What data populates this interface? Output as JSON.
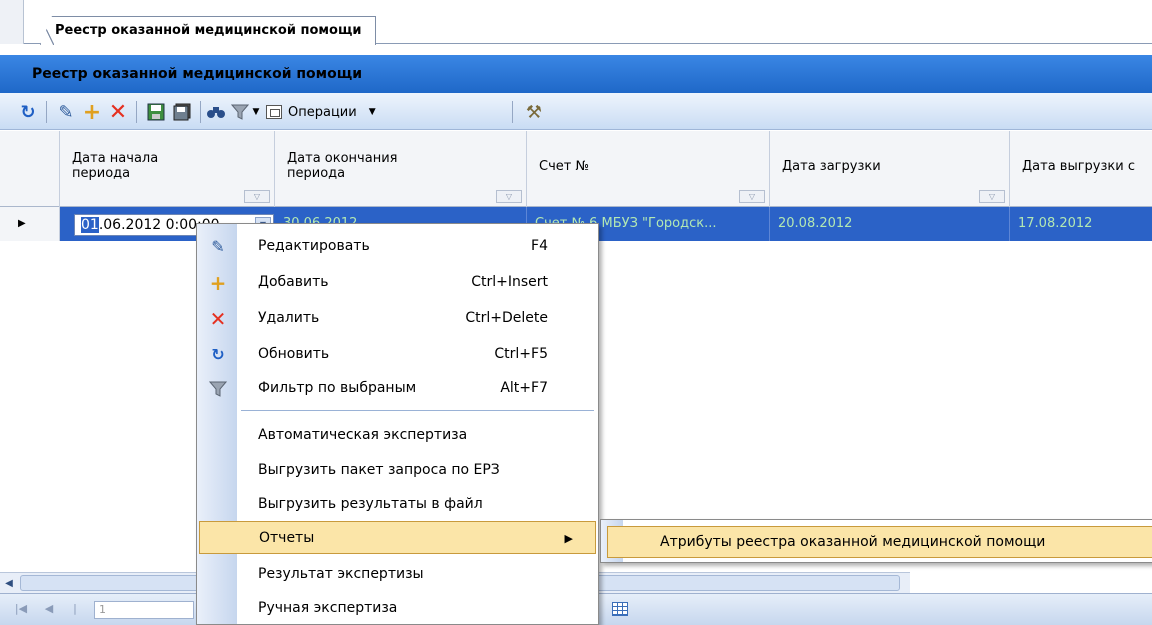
{
  "tab": {
    "label": "Реестр оказанной медицинской помощи"
  },
  "panel": {
    "title": "Реестр оказанной медицинской помощи"
  },
  "toolbar": {
    "operations_label": "Операции",
    "icons": [
      "refresh-icon",
      "edit-icon",
      "add-icon",
      "delete-icon",
      "save-icon",
      "save-all-icon",
      "find-icon",
      "filter-icon",
      "operations-icon",
      "tools-icon"
    ]
  },
  "grid": {
    "columns": [
      {
        "label": "Дата начала периода"
      },
      {
        "label": "Дата окончания периода"
      },
      {
        "label": "Счет №"
      },
      {
        "label": "Дата загрузки"
      },
      {
        "label": "Дата выгрузки с"
      }
    ],
    "row": {
      "edit_value_selected": "01",
      "edit_value_rest": ".06.2012  0:00:00",
      "end_date": "30.06.2012",
      "account": "Счет № 6 МБУЗ \"Городск...",
      "load_date": "20.08.2012",
      "unload_date": "17.08.2012"
    }
  },
  "navigator": {
    "page_value": "1"
  },
  "context_menu": {
    "items": [
      {
        "label": "Редактировать",
        "shortcut": "F4"
      },
      {
        "label": "Добавить",
        "shortcut": "Ctrl+Insert"
      },
      {
        "label": "Удалить",
        "shortcut": "Ctrl+Delete"
      },
      {
        "label": "Обновить",
        "shortcut": "Ctrl+F5"
      },
      {
        "label": "Фильтр по выбраным",
        "shortcut": "Alt+F7"
      },
      {
        "label": "Автоматическая экспертиза"
      },
      {
        "label": "Выгрузить пакет запроса по ЕРЗ"
      },
      {
        "label": "Выгрузить результаты в файл"
      },
      {
        "label": "Отчеты"
      },
      {
        "label": "Результат экспертизы"
      },
      {
        "label": "Ручная экспертиза"
      }
    ]
  },
  "submenu": {
    "items": [
      {
        "label": "Атрибуты реестра оказанной медицинской помощи"
      }
    ]
  },
  "colors": {
    "header_blue": "#2e7bd8",
    "selection_blue": "#2b62c7",
    "highlight": "#fbe5a8"
  }
}
